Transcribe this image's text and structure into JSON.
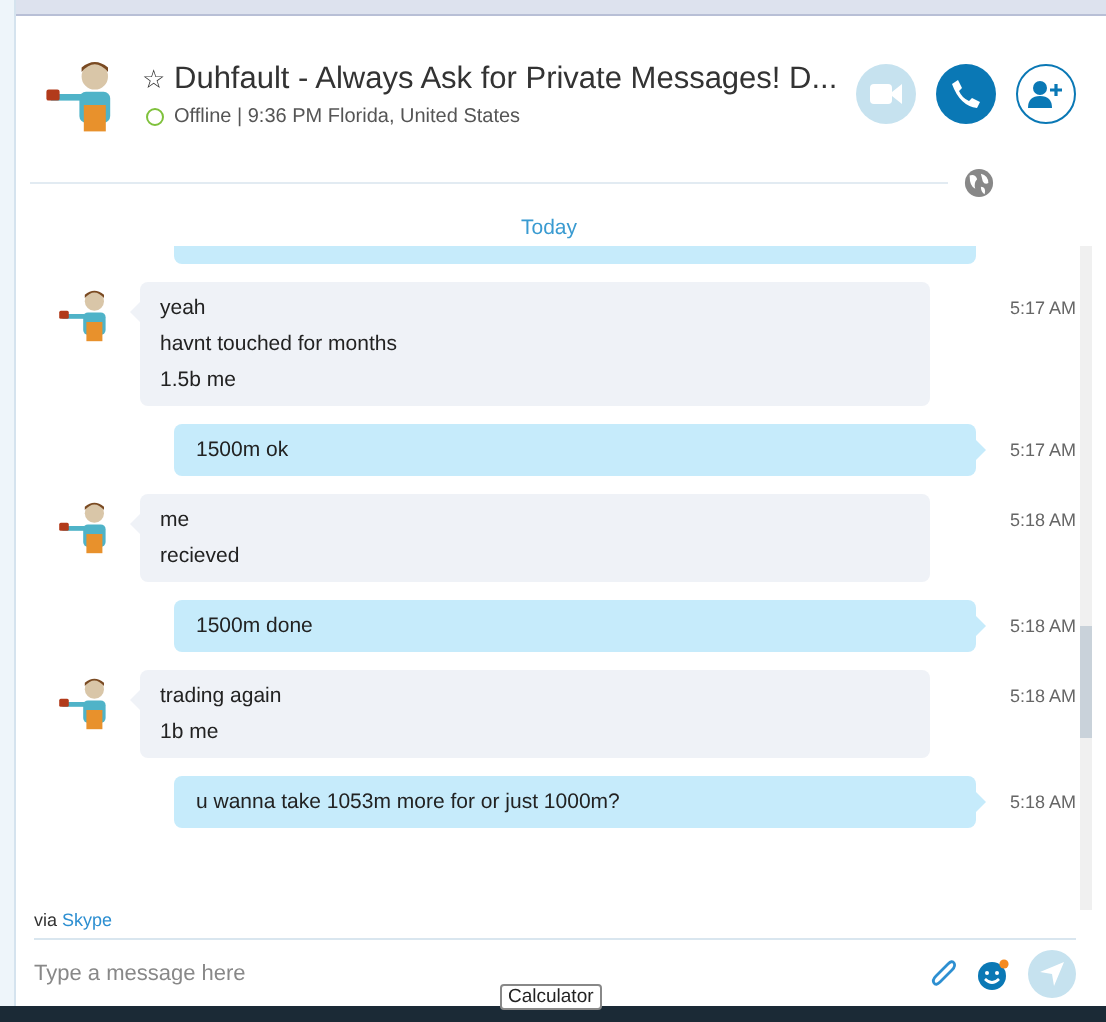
{
  "contact": {
    "star": "☆",
    "name": "Duhfault - Always Ask for Private Messages! D...",
    "status_line": "Offline | 9:36 PM Florida, United States"
  },
  "call_buttons": [
    {
      "kind": "video",
      "disabled": true
    },
    {
      "kind": "call",
      "disabled": false
    },
    {
      "kind": "add",
      "disabled": false
    }
  ],
  "day_label": "Today",
  "messages": [
    {
      "kind": "incoming",
      "lines": [
        "yeah",
        "havnt touched for months",
        "1.5b me"
      ],
      "time": "5:17 AM"
    },
    {
      "kind": "outgoing",
      "lines": [
        "1500m ok"
      ],
      "time": "5:17 AM"
    },
    {
      "kind": "incoming",
      "lines": [
        "me",
        "recieved"
      ],
      "time": "5:18 AM"
    },
    {
      "kind": "outgoing",
      "lines": [
        "1500m done"
      ],
      "time": "5:18 AM"
    },
    {
      "kind": "incoming",
      "lines": [
        "trading again",
        "1b me"
      ],
      "time": "5:18 AM"
    },
    {
      "kind": "outgoing",
      "lines": [
        "u wanna take 1053m more for or just 1000m?"
      ],
      "time": "5:18 AM"
    }
  ],
  "via": {
    "prefix": "via",
    "link": "Skype"
  },
  "composer": {
    "placeholder": "Type a message here"
  },
  "tooltip": "Calculator"
}
